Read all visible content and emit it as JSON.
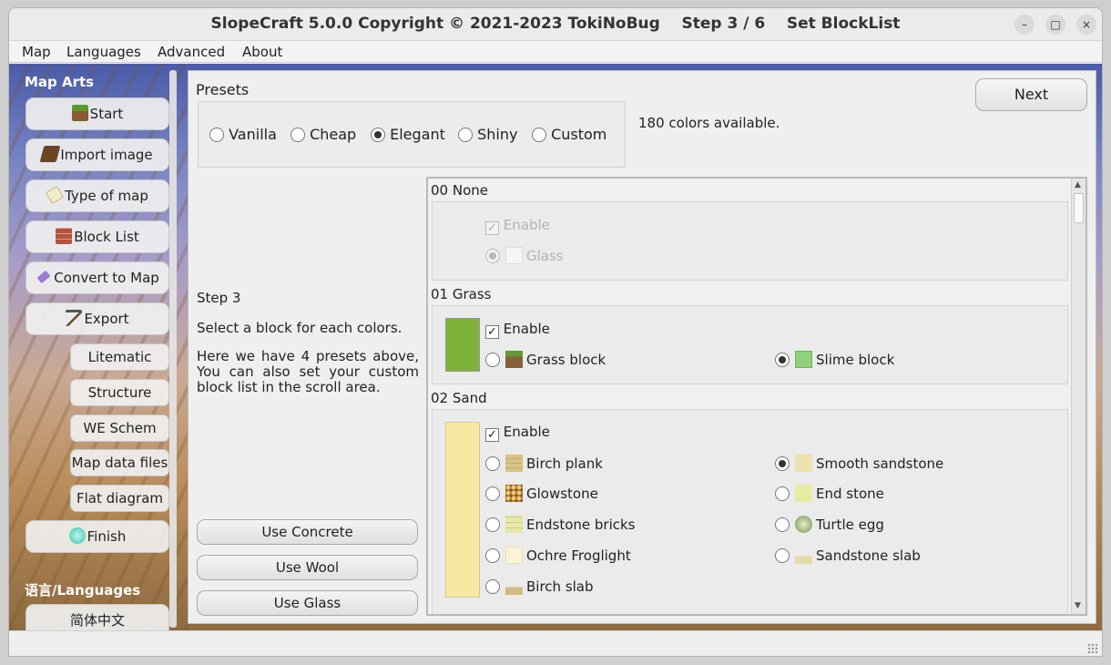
{
  "window": {
    "title": "SlopeCraft 5.0.0 Copyright © 2021-2023 TokiNoBug    Step 3 / 6    Set BlockList",
    "minimize_icon": "–",
    "maximize_icon": "□",
    "close_icon": "×"
  },
  "menubar": {
    "items": [
      "Map",
      "Languages",
      "Advanced",
      "About"
    ]
  },
  "sidebar": {
    "heading": "Map Arts",
    "buttons": [
      {
        "label": "Start",
        "icon": "grass-block-icon"
      },
      {
        "label": "Import image",
        "icon": "book-icon"
      },
      {
        "label": "Type of map",
        "icon": "map-icon"
      },
      {
        "label": "Block List",
        "icon": "bricks-icon"
      },
      {
        "label": "Convert to Map",
        "icon": "eraser-icon"
      },
      {
        "label": "Export",
        "icon": "pickaxe-icon"
      }
    ],
    "export_sub": [
      "Litematic",
      "Structure",
      "WE Schem",
      "Map data files",
      "Flat diagram"
    ],
    "finish": {
      "label": "Finish",
      "icon": "diamond-icon"
    },
    "lang_heading": "语言/Languages",
    "lang_button": "简体中文"
  },
  "presets": {
    "label": "Presets",
    "options": [
      "Vanilla",
      "Cheap",
      "Elegant",
      "Shiny",
      "Custom"
    ],
    "selected": "Elegant"
  },
  "colors_info": "180 colors available.",
  "next_button": "Next",
  "step": {
    "title": "Step 3",
    "line1": "Select a block for each colors.",
    "line2": "Here we have 4 presets above, You can also set your custom block list in the scroll area."
  },
  "actions": [
    "Use Concrete",
    "Use Wool",
    "Use Glass"
  ],
  "block_groups": [
    {
      "title": "00 None",
      "enable_label": "Enable",
      "blocks": [
        {
          "name": "Glass",
          "selected": true
        }
      ]
    },
    {
      "title": "01 Grass",
      "enable_label": "Enable",
      "color": "#7fb238",
      "blocks": [
        {
          "name": "Grass block",
          "selected": false
        },
        {
          "name": "Slime block",
          "selected": true
        }
      ]
    },
    {
      "title": "02 Sand",
      "enable_label": "Enable",
      "color": "#f7e9a3",
      "blocks": [
        {
          "name": "Birch plank",
          "selected": false
        },
        {
          "name": "Smooth sandstone",
          "selected": true
        },
        {
          "name": "Glowstone",
          "selected": false
        },
        {
          "name": "End stone",
          "selected": false
        },
        {
          "name": "Endstone bricks",
          "selected": false
        },
        {
          "name": "Turtle egg",
          "selected": false
        },
        {
          "name": "Ochre Froglight",
          "selected": false
        },
        {
          "name": "Sandstone slab",
          "selected": false
        },
        {
          "name": "Birch slab",
          "selected": false
        }
      ]
    }
  ]
}
